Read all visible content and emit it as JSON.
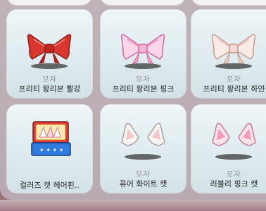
{
  "items": [
    {
      "category": "모자",
      "name": "프리티 왕리본 빨강",
      "icon": "red-ribbon-bow-icon",
      "color": "#d8362f"
    },
    {
      "category": "모자",
      "name": "프리티 왕리본 핑크",
      "icon": "pink-ribbon-bow-icon",
      "color": "#f6b3d3"
    },
    {
      "category": "모자",
      "name": "프리티 왕리본 하얀",
      "icon": "white-ribbon-bow-icon",
      "color": "#f3dcd6"
    },
    {
      "category": "",
      "name": "컬러즈 캣 헤어핀..",
      "icon": "colors-cat-hairpin-box-icon",
      "color": "#e33a3a"
    },
    {
      "category": "모자",
      "name": "퓨어 화이트 캣",
      "icon": "white-cat-ears-icon",
      "color": "#f5f1f0"
    },
    {
      "category": "모자",
      "name": "러블리 핑크 캣",
      "icon": "pink-cat-ears-icon",
      "color": "#f4a9c2"
    }
  ]
}
